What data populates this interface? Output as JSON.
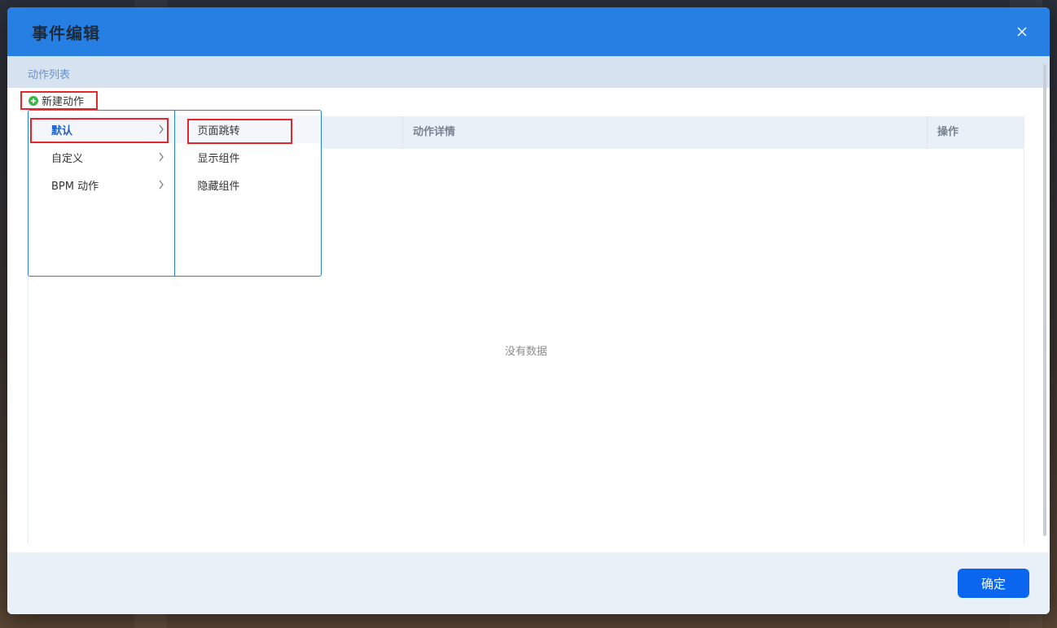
{
  "dialog": {
    "title": "事件编辑",
    "close_icon": "close-icon"
  },
  "section": {
    "title": "动作列表"
  },
  "toolbar": {
    "new_action_label": "新建动作",
    "new_action_icon": "plus-circle-icon"
  },
  "table": {
    "columns": [
      "",
      "动作详情",
      "操作"
    ],
    "empty_text": "没有数据"
  },
  "cascader": {
    "level1": [
      {
        "label": "默认",
        "active": true
      },
      {
        "label": "自定义",
        "active": false
      },
      {
        "label": "BPM 动作",
        "active": false
      }
    ],
    "level2": [
      {
        "label": "页面跳转",
        "active": true
      },
      {
        "label": "显示组件",
        "active": false
      },
      {
        "label": "隐藏组件",
        "active": false
      }
    ]
  },
  "footer": {
    "confirm_label": "确定"
  },
  "colors": {
    "header_blue": "#2680e3",
    "primary_button": "#0a66ef",
    "highlight_red": "#e5272d",
    "plus_green": "#3fb44a"
  }
}
